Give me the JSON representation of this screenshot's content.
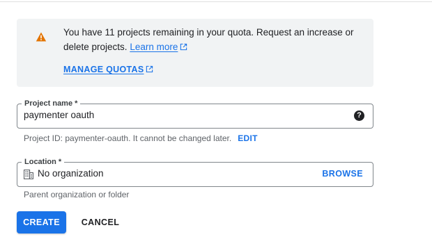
{
  "quota_notice": {
    "message": "You have 11 projects remaining in your quota. Request an increase or delete projects.",
    "learn_more_label": "Learn more",
    "manage_quotas_label": "MANAGE QUOTAS",
    "icon": "warning-icon"
  },
  "project_name": {
    "label": "Project name *",
    "value": "paymenter oauth",
    "help_icon": "help-icon"
  },
  "project_id": {
    "text": "Project ID: paymenter-oauth. It cannot be changed later.",
    "edit_label": "EDIT"
  },
  "location": {
    "label": "Location *",
    "value": "No organization",
    "browse_label": "BROWSE",
    "icon": "building-icon",
    "hint": "Parent organization or folder"
  },
  "actions": {
    "create_label": "CREATE",
    "cancel_label": "CANCEL"
  },
  "colors": {
    "accent": "#1a73e8",
    "warning": "#e37400",
    "notice_bg": "#f1f3f4"
  }
}
